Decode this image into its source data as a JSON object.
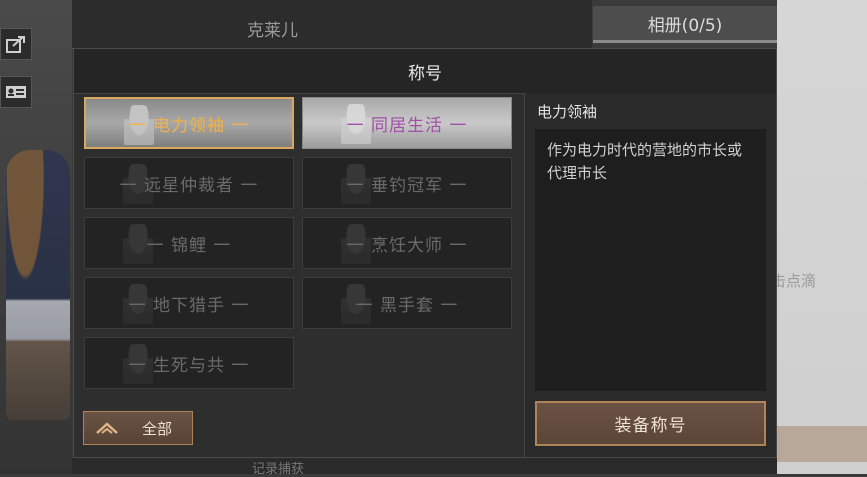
{
  "background": {
    "top_left_tab": "克莱儿",
    "top_right_tab": "相册(0/5)",
    "right_hint": "击点滴",
    "bottom_text": "记录捕获"
  },
  "dialog": {
    "title": "称号",
    "titles": [
      {
        "label": "一 电力领袖 一",
        "state": "selected"
      },
      {
        "label": "一 同居生活 一",
        "state": "owned"
      },
      {
        "label": "一 远星仲裁者 一",
        "state": "locked"
      },
      {
        "label": "一 垂钓冠军 一",
        "state": "locked"
      },
      {
        "label": "一 锦鲤 一",
        "state": "locked"
      },
      {
        "label": "一 烹饪大师 一",
        "state": "locked"
      },
      {
        "label": "一 地下猎手 一",
        "state": "locked"
      },
      {
        "label": "一 黑手套 一",
        "state": "locked"
      },
      {
        "label": "一 生死与共 一",
        "state": "locked"
      }
    ],
    "detail": {
      "name": "电力领袖",
      "description": "作为电力时代的营地的市长或代理市长"
    },
    "equip_button": "装备称号",
    "filter_button": "全部"
  },
  "colors": {
    "selected_text": "#f0b24a",
    "owned_text": "#a24fa6",
    "locked_text": "#6a6a6a",
    "button_border": "#b08458"
  }
}
